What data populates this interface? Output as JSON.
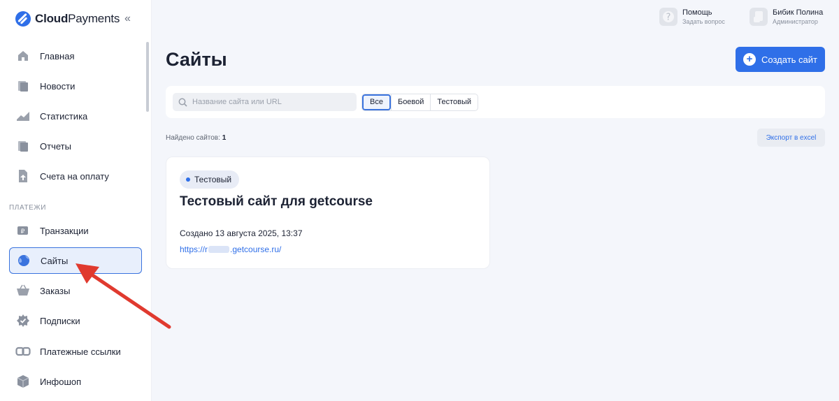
{
  "app": {
    "logo_bold": "Cloud",
    "logo_light": "Payments",
    "collapse_glyph": "«"
  },
  "sidebar": {
    "items": [
      {
        "label": "Главная",
        "icon": "home-icon"
      },
      {
        "label": "Новости",
        "icon": "news-icon"
      },
      {
        "label": "Статистика",
        "icon": "stats-icon"
      },
      {
        "label": "Отчеты",
        "icon": "reports-icon"
      },
      {
        "label": "Счета на оплату",
        "icon": "invoice-icon"
      }
    ],
    "section_label": "ПЛАТЕЖИ",
    "payments_items": [
      {
        "label": "Транзакции",
        "icon": "transactions-icon"
      },
      {
        "label": "Сайты",
        "icon": "sites-icon",
        "active": true
      },
      {
        "label": "Заказы",
        "icon": "basket-icon"
      },
      {
        "label": "Подписки",
        "icon": "subscriptions-icon"
      },
      {
        "label": "Платежные ссылки",
        "icon": "link-icon"
      },
      {
        "label": "Инфошоп",
        "icon": "box-icon"
      }
    ]
  },
  "topbar": {
    "help_title": "Помощь",
    "help_sub": "Задать вопрос",
    "user_name": "Бибик Полина",
    "user_role": "Администратор"
  },
  "main": {
    "title": "Сайты",
    "create_button": "Создать сайт",
    "search_placeholder": "Название сайта или URL",
    "filters": [
      "Все",
      "Боевой",
      "Тестовый"
    ],
    "selected_filter": "Все",
    "found_label": "Найдено сайтов:",
    "found_count": "1",
    "export_button": "Экспорт в excel"
  },
  "card": {
    "badge": "Тестовый",
    "title": "Тестовый сайт для getcourse",
    "created": "Создано 13 августа 2025, 13:37",
    "url_prefix": "https://r",
    "url_suffix": ".getcourse.ru/"
  },
  "colors": {
    "accent": "#2f6fe8",
    "annotation_arrow": "#e03a2f"
  }
}
